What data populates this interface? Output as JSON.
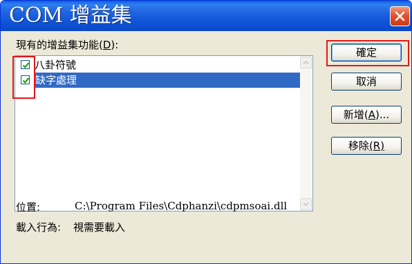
{
  "window": {
    "title": "COM 增益集"
  },
  "features": {
    "label_prefix": "現有的增益集功能(",
    "label_key": "D",
    "label_suffix": "):",
    "items": [
      {
        "label": "八卦符號",
        "checked": true,
        "selected": false
      },
      {
        "label": "缺字處理",
        "checked": true,
        "selected": true
      }
    ]
  },
  "buttons": {
    "ok": "確定",
    "cancel": "取消",
    "add_prefix": "新增(",
    "add_key": "A",
    "add_suffix": ")...",
    "remove_prefix": "移除",
    "remove_key": "(R)"
  },
  "info": {
    "location_label": "位置:",
    "location_value": "C:\\Program Files\\Cdphanzi\\cdpmsoai.dll",
    "load_label": "載入行為:",
    "load_value": "視需要載入"
  },
  "colors": {
    "selection": "#316ac5",
    "annotation": "#e01818",
    "titlebar": "#0d52d6"
  }
}
